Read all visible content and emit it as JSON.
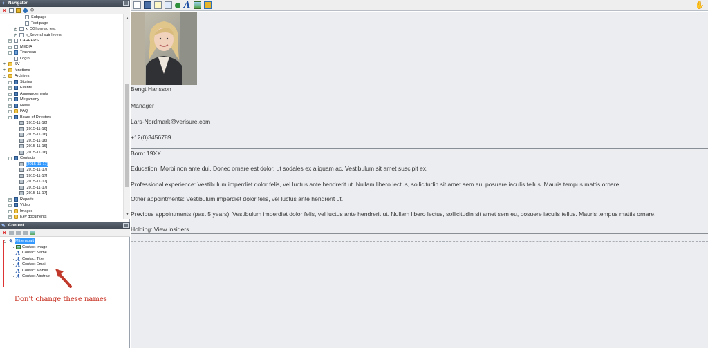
{
  "navigator": {
    "title": "Navigator",
    "tree": [
      {
        "label": "Subpage",
        "indent": 4,
        "icon": "page"
      },
      {
        "label": "Test page",
        "indent": 4,
        "icon": "page"
      },
      {
        "label": "x_CGI pre ac test",
        "indent": 3,
        "icon": "page",
        "expander": "+"
      },
      {
        "label": "x_Several sub-levels",
        "indent": 3,
        "icon": "page",
        "expander": "+"
      },
      {
        "label": "CAREERS",
        "indent": 2,
        "icon": "page",
        "expander": "+"
      },
      {
        "label": "MEDIA",
        "indent": 2,
        "icon": "page",
        "expander": "+"
      },
      {
        "label": "Trashcan",
        "indent": 2,
        "icon": "trash",
        "expander": "+"
      },
      {
        "label": "Login",
        "indent": 2,
        "icon": "page"
      },
      {
        "label": "SV",
        "indent": 1,
        "icon": "folder",
        "expander": "+"
      },
      {
        "label": "functions",
        "indent": 1,
        "icon": "folder",
        "expander": "+"
      },
      {
        "label": "Archives",
        "indent": 1,
        "icon": "folder",
        "expander": "-"
      },
      {
        "label": "Stories",
        "indent": 2,
        "icon": "book",
        "expander": "+"
      },
      {
        "label": "Events",
        "indent": 2,
        "icon": "book",
        "expander": "+"
      },
      {
        "label": "Announcements",
        "indent": 2,
        "icon": "book",
        "expander": "+"
      },
      {
        "label": "Megameny",
        "indent": 2,
        "icon": "book",
        "expander": "+"
      },
      {
        "label": "News",
        "indent": 2,
        "icon": "book",
        "expander": "+"
      },
      {
        "label": "FAQ",
        "indent": 2,
        "icon": "folder",
        "expander": "+"
      },
      {
        "label": "Board of Directors",
        "indent": 2,
        "icon": "book",
        "expander": "-"
      },
      {
        "label": "[2015-11-16]",
        "indent": 3,
        "icon": "clip"
      },
      {
        "label": "[2015-11-16]",
        "indent": 3,
        "icon": "clip"
      },
      {
        "label": "[2015-11-16]",
        "indent": 3,
        "icon": "clip"
      },
      {
        "label": "[2015-11-16]",
        "indent": 3,
        "icon": "clip"
      },
      {
        "label": "[2015-11-16]",
        "indent": 3,
        "icon": "clip"
      },
      {
        "label": "[2015-11-16]",
        "indent": 3,
        "icon": "clip"
      },
      {
        "label": "Contacts",
        "indent": 2,
        "icon": "book",
        "expander": "-"
      },
      {
        "label": "[2015-11-17]",
        "indent": 3,
        "icon": "clip",
        "selected": true
      },
      {
        "label": "[2015-11-17]",
        "indent": 3,
        "icon": "clip"
      },
      {
        "label": "[2015-11-17]",
        "indent": 3,
        "icon": "clip"
      },
      {
        "label": "[2015-11-17]",
        "indent": 3,
        "icon": "clip"
      },
      {
        "label": "[2015-11-17]",
        "indent": 3,
        "icon": "clip"
      },
      {
        "label": "[2015-11-17]",
        "indent": 3,
        "icon": "clip"
      },
      {
        "label": "Reports",
        "indent": 2,
        "icon": "book",
        "expander": "+"
      },
      {
        "label": "Video",
        "indent": 2,
        "icon": "book",
        "expander": "+"
      },
      {
        "label": "Images",
        "indent": 2,
        "icon": "folder",
        "expander": "+"
      },
      {
        "label": "Key documents",
        "indent": 2,
        "icon": "folder",
        "expander": "+"
      }
    ]
  },
  "content": {
    "title": "Content",
    "root_label": "Mittenspalt",
    "items": [
      {
        "label": "Contact Image",
        "icon": "image"
      },
      {
        "label": "Contact Name",
        "icon": "text"
      },
      {
        "label": "Contact Title",
        "icon": "text"
      },
      {
        "label": "Contact Email",
        "icon": "text"
      },
      {
        "label": "Contact Mobile",
        "icon": "text"
      },
      {
        "label": "Contact Abstract",
        "icon": "text"
      }
    ],
    "annotation": "Don't change these names",
    "annotation_color": "#c62d1e"
  },
  "editor": {
    "name": "Bengt Hansson",
    "title": "Manager",
    "email": "Lars-Nordmark@verisure.com",
    "phone": "+12(0)3456789",
    "born": "Born: 19XX",
    "education": "Education: Morbi non ante dui. Donec ornare est dolor, ut sodales ex aliquam ac. Vestibulum sit amet suscipit ex.",
    "professional": "Professional experience: Vestibulum imperdiet dolor felis, vel luctus ante hendrerit ut. Nullam libero lectus, sollicitudin sit amet sem eu, posuere iaculis tellus. Mauris tempus mattis ornare.",
    "other": "Other appointments: Vestibulum imperdiet dolor felis, vel luctus ante hendrerit ut.",
    "previous": "Previous appointments (past 5 years): Vestibulum imperdiet dolor felis, vel luctus ante hendrerit ut. Nullam libero lectus, sollicitudin sit amet sem eu, posuere iaculis tellus. Mauris tempus mattis ornare.",
    "holding": "Holding: View insiders."
  },
  "icons": {
    "navigator_toolbar": [
      "close-icon",
      "properties-icon",
      "cube-icon",
      "globe-icon",
      "search-icon"
    ],
    "content_toolbar": [
      "close-icon",
      "delete-icon",
      "copy-icon",
      "paste-icon",
      "image-icon"
    ],
    "editor_toolbar": [
      "page-icon",
      "save-icon",
      "search-page-icon",
      "export-icon",
      "publish-icon",
      "text-icon",
      "image-icon",
      "module-icon"
    ]
  }
}
